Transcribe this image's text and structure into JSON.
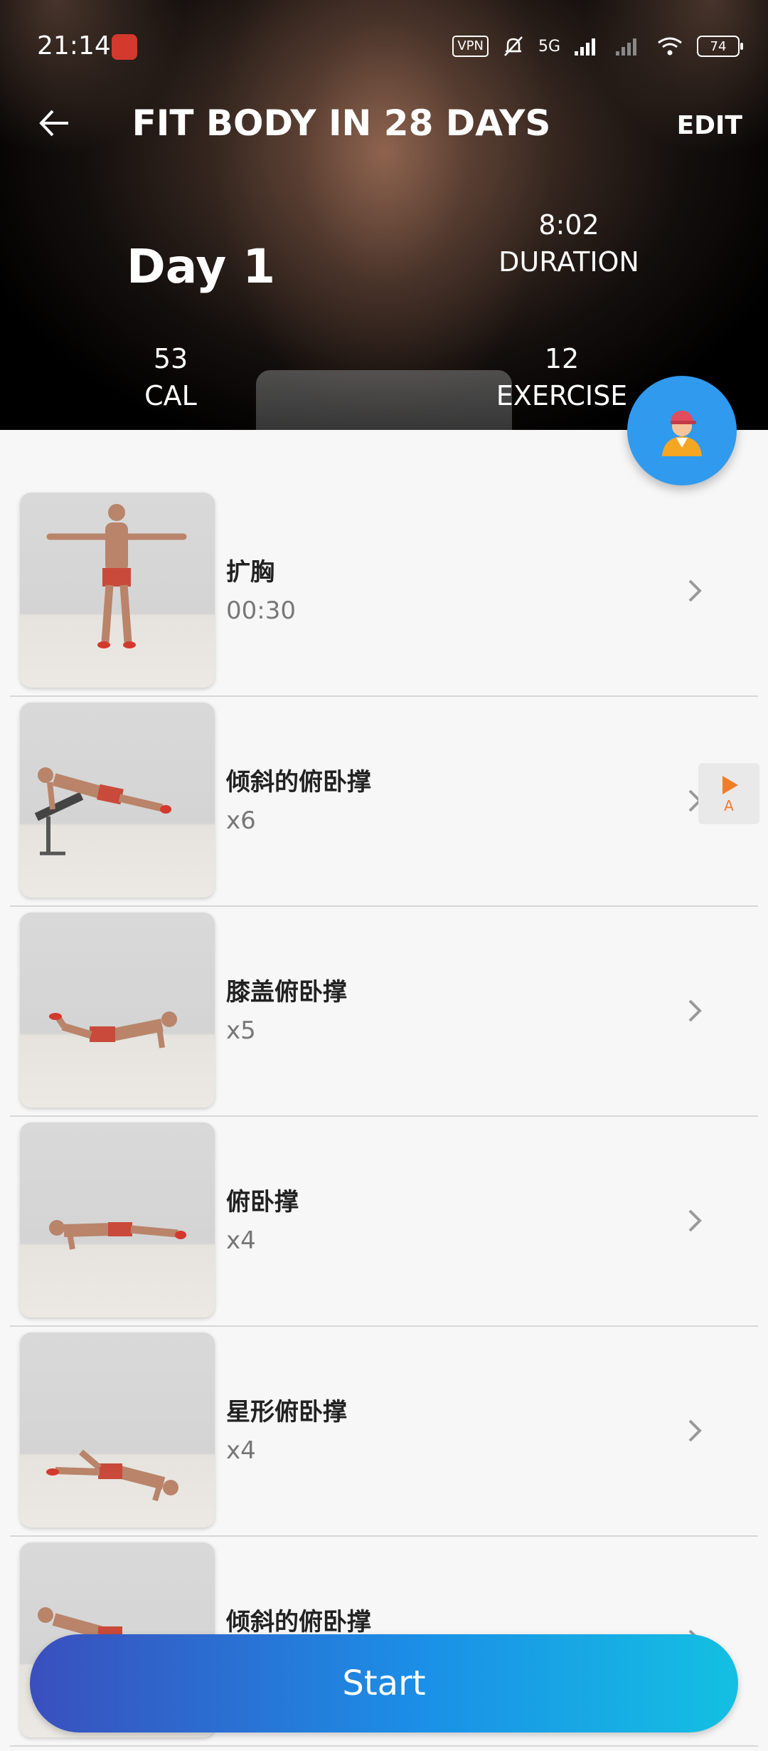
{
  "status_bar": {
    "time": "21:14",
    "vpn": "VPN",
    "network": "5G",
    "battery": "74"
  },
  "header": {
    "title": "FIT BODY IN 28 DAYS",
    "edit_label": "EDIT",
    "day_label": "Day 1",
    "duration_value": "8:02",
    "duration_label": "DURATION",
    "cal_value": "53",
    "cal_label": "CAL",
    "exercise_value": "12",
    "exercise_label": "EXERCISE"
  },
  "exercises": [
    {
      "name": "扩胸",
      "detail": "00:30"
    },
    {
      "name": "倾斜的俯卧撑",
      "detail": "x6"
    },
    {
      "name": "膝盖俯卧撑",
      "detail": "x5"
    },
    {
      "name": "俯卧撑",
      "detail": "x4"
    },
    {
      "name": "星形俯卧撑",
      "detail": "x4"
    },
    {
      "name": "倾斜的俯卧撑",
      "detail": ""
    }
  ],
  "float_play_label": "A",
  "start_label": "Start",
  "colors": {
    "fab": "#2f9aee",
    "start_gradient_start": "#3a4fbd",
    "start_gradient_end": "#14c0e2"
  }
}
